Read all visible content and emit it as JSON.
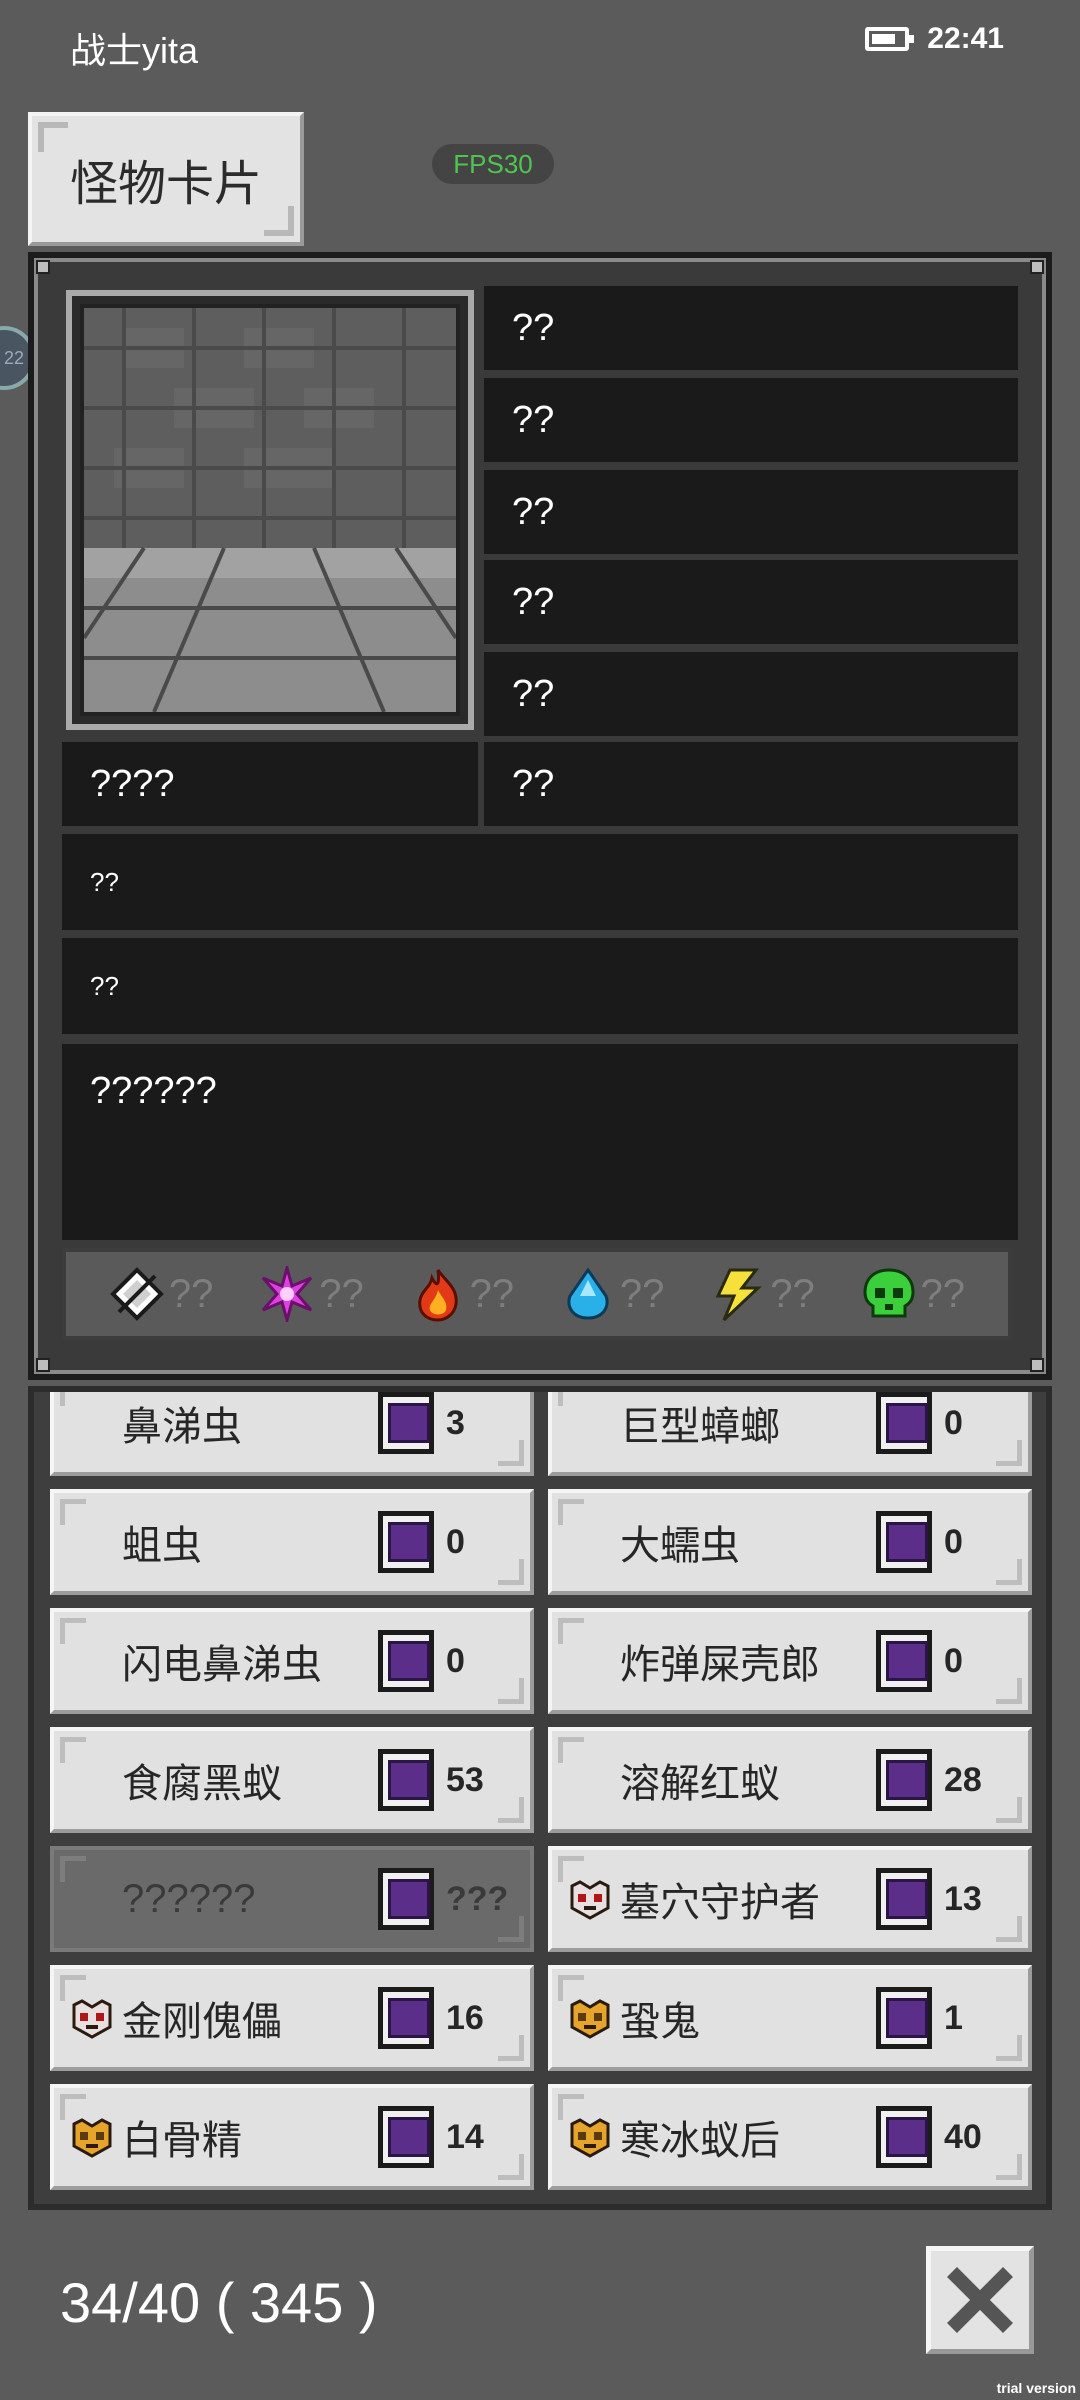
{
  "status_bar": {
    "player_name": "战士yita",
    "time": "22:41",
    "battery_level": 0.75
  },
  "header": {
    "title": "怪物卡片",
    "fps_label": "FPS30"
  },
  "side_bubble": {
    "label": "22"
  },
  "card": {
    "stats": [
      "??",
      "??",
      "??",
      "??",
      "??"
    ],
    "name": "????",
    "level": "??",
    "desc_1": "??",
    "desc_2": "??",
    "description": "??????",
    "elements": [
      {
        "name": "physical",
        "icon": "diamond-shield-icon",
        "value": "??"
      },
      {
        "name": "arcane",
        "icon": "magenta-spark-icon",
        "value": "??"
      },
      {
        "name": "fire",
        "icon": "flame-icon",
        "value": "??"
      },
      {
        "name": "water",
        "icon": "water-drop-icon",
        "value": "??"
      },
      {
        "name": "lightning",
        "icon": "lightning-icon",
        "value": "??"
      },
      {
        "name": "poison",
        "icon": "green-skull-icon",
        "value": "??"
      }
    ]
  },
  "monsters": [
    {
      "name": "鼻涕虫",
      "count": "3",
      "icon": "",
      "locked": false
    },
    {
      "name": "巨型蟑螂",
      "count": "0",
      "icon": "",
      "locked": false
    },
    {
      "name": "蛆虫",
      "count": "0",
      "icon": "",
      "locked": false
    },
    {
      "name": "大蠕虫",
      "count": "0",
      "icon": "",
      "locked": false
    },
    {
      "name": "闪电鼻涕虫",
      "count": "0",
      "icon": "",
      "locked": false
    },
    {
      "name": "炸弹屎壳郎",
      "count": "0",
      "icon": "",
      "locked": false
    },
    {
      "name": "食腐黑蚁",
      "count": "53",
      "icon": "",
      "locked": false
    },
    {
      "name": "溶解红蚁",
      "count": "28",
      "icon": "",
      "locked": false
    },
    {
      "name": "??????",
      "count": "???",
      "icon": "",
      "locked": true
    },
    {
      "name": "墓穴守护者",
      "count": "13",
      "icon": "red-boss-mask-icon",
      "locked": false
    },
    {
      "name": "金刚傀儡",
      "count": "16",
      "icon": "red-boss-mask-icon",
      "locked": false
    },
    {
      "name": "蛩鬼",
      "count": "1",
      "icon": "gold-boss-mask-icon",
      "locked": false
    },
    {
      "name": "白骨精",
      "count": "14",
      "icon": "gold-boss-mask-icon",
      "locked": false
    },
    {
      "name": "寒冰蚁后",
      "count": "40",
      "icon": "gold-boss-mask-icon",
      "locked": false
    }
  ],
  "footer": {
    "progress_text": "34/40 ( 345 )"
  },
  "watermark": "trial version",
  "colors": {
    "fps_text": "#4fc54f",
    "card_slot": "#1a1a1a",
    "book_purple": "#5b2e8a"
  }
}
